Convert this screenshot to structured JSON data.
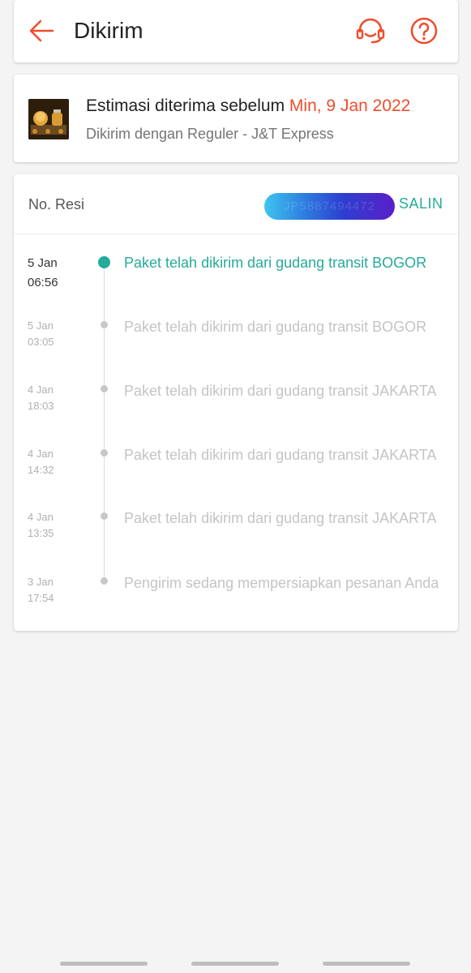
{
  "header": {
    "title": "Dikirim",
    "back_icon": "arrow-left-icon",
    "support_icon": "headset-icon",
    "help_icon": "question-circle-icon",
    "accent_color": "#ee4d2d"
  },
  "estimate": {
    "prefix": "Estimasi diterima sebelum ",
    "date": "Min, 9 Jan 2022",
    "shipping": "Dikirim dengan Reguler - J&T Express"
  },
  "tracking": {
    "resi_label": "No. Resi",
    "resi_value": "JP5887494472",
    "copy_label": "SALIN",
    "events": [
      {
        "date": "5 Jan",
        "time": "06:56",
        "text": "Paket telah dikirim dari gudang transit BOGOR",
        "active": true
      },
      {
        "date": "5 Jan",
        "time": "03:05",
        "text": "Paket telah dikirim dari gudang transit BOGOR",
        "active": false
      },
      {
        "date": "4 Jan",
        "time": "18:03",
        "text": "Paket telah dikirim dari gudang transit JAKARTA",
        "active": false
      },
      {
        "date": "4 Jan",
        "time": "14:32",
        "text": "Paket telah dikirim dari gudang transit JAKARTA",
        "active": false
      },
      {
        "date": "4 Jan",
        "time": "13:35",
        "text": "Paket telah dikirim dari gudang transit JAKARTA",
        "active": false
      },
      {
        "date": "3 Jan",
        "time": "17:54",
        "text": "Pengirim sedang mempersiapkan pesanan Anda",
        "active": false
      }
    ],
    "status_color": "#26aa99"
  }
}
